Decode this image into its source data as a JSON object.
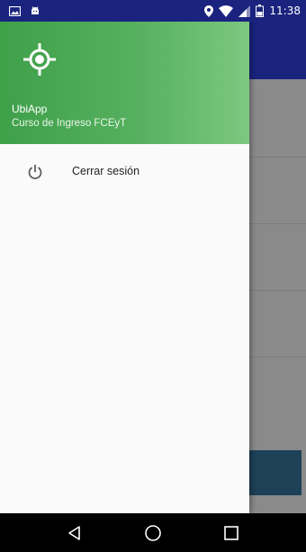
{
  "status_bar": {
    "time": "11:38",
    "icons": [
      "image-icon",
      "android-icon",
      "location-icon",
      "wifi-icon",
      "signal-icon",
      "battery-icon"
    ]
  },
  "drawer": {
    "app_name": "UbiApp",
    "subtitle": "Curso de Ingreso FCEyT",
    "logo_icon": "location-target-icon",
    "items": [
      {
        "label": "Cerrar sesión",
        "icon": "power-icon"
      }
    ]
  },
  "nav_bar": {
    "buttons": [
      "back-icon",
      "home-icon",
      "recents-icon"
    ]
  },
  "colors": {
    "status_bar": "#1a237e",
    "drawer_header_start": "#3fa04a",
    "drawer_header_end": "#7cc880",
    "background_dim": "#8a8a8a"
  }
}
